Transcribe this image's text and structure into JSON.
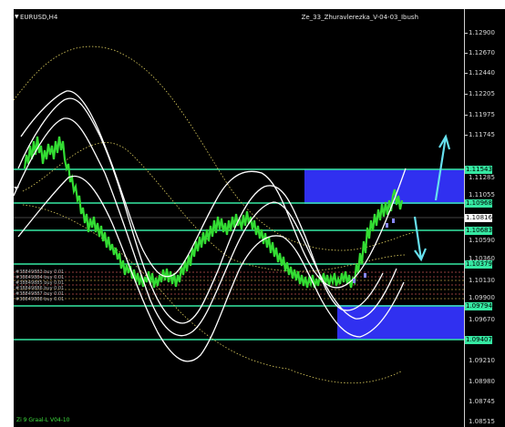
{
  "window": {
    "symbol": "EURUSD,H4",
    "indicator": "Ze_33_Zhuravlerezka_V-04-03_Ibush",
    "expert": "Zi 9 Graal-L V04-10"
  },
  "price_axis": {
    "ticks": [
      "1.12900",
      "1.12670",
      "1.12440",
      "1.12205",
      "1.11975",
      "1.11745",
      "1.11285",
      "1.11055",
      "1.10590",
      "1.10360",
      "1.10130",
      "1.09900",
      "1.09670",
      "1.09210",
      "1.08980",
      "1.08745",
      "1.08515"
    ],
    "level_labels": [
      "1.11543",
      "1.10968",
      "1.10683",
      "1.10379",
      "1.09794",
      "1.09407"
    ],
    "current_price": "1.10816"
  },
  "orders": [
    {
      "label": "#38849883 buy 0.01"
    },
    {
      "label": "#38849884 buy 0.01"
    },
    {
      "label": "#38849885 buy 0.01"
    },
    {
      "label": "#38849886 buy 0.01"
    },
    {
      "label": "#38849887 buy 0.01"
    },
    {
      "label": "#38849888 buy 0.01"
    }
  ],
  "colors": {
    "background": "#000000",
    "level_line": "#35e8a2",
    "zone_fill": "#3030f0",
    "forecast_arrow": "#66e0ee",
    "candles": "#33dd33",
    "channel": "#ffffff",
    "ma": "#e0d060"
  }
}
